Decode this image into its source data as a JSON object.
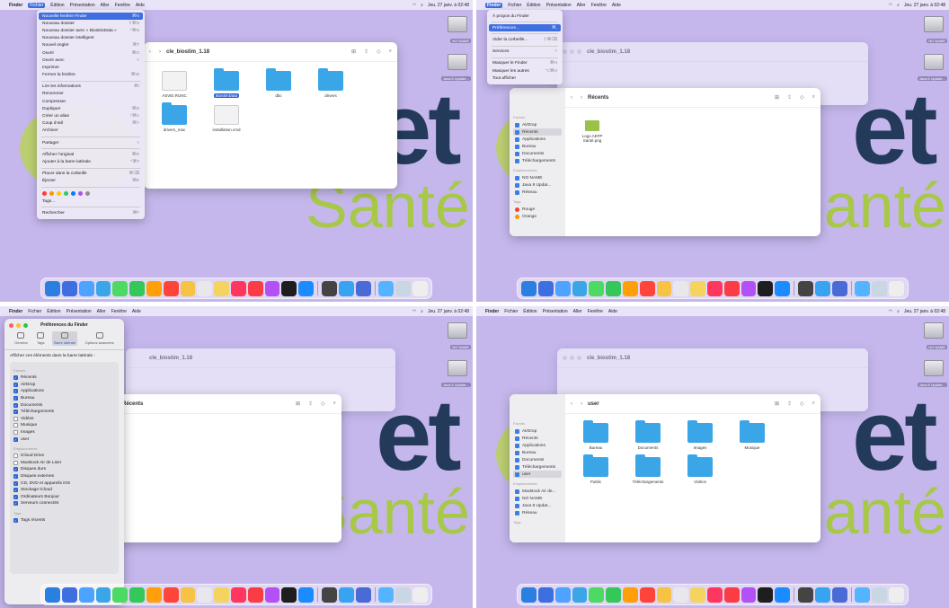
{
  "menubar": {
    "apple": "",
    "app": "Finder",
    "items": [
      "Fichier",
      "Édition",
      "Présentation",
      "Aller",
      "Fenêtre",
      "Aide"
    ],
    "clock": "Jeu. 27 janv. à 02:48"
  },
  "desktop": {
    "wall_big": "et",
    "wall_small": "Santé",
    "disk1": "NO NAME",
    "disk2": "Java 8 Update..."
  },
  "p1": {
    "window_title": "cle_biostim_1.18",
    "files": [
      {
        "name": "ASVEI.RUNC",
        "kind": "file"
      },
      {
        "name": "BiostimData",
        "kind": "folder",
        "selected": true
      },
      {
        "name": "dbc",
        "kind": "folder"
      },
      {
        "name": "drivers",
        "kind": "folder"
      },
      {
        "name": "drivers_mac",
        "kind": "folder"
      },
      {
        "name": "installation.cmd",
        "kind": "file"
      }
    ],
    "menu": [
      {
        "label": "Nouvelle fenêtre Finder",
        "sc": "⌘N",
        "hl": true
      },
      {
        "label": "Nouveau dossier",
        "sc": "⇧⌘N"
      },
      {
        "label": "Nouveau dossier avec « BiostimData »",
        "sc": "^⌘N"
      },
      {
        "label": "Nouveau dossier intelligent",
        "sc": ""
      },
      {
        "label": "Nouvel onglet",
        "sc": "⌘T"
      },
      {
        "label": "Ouvrir",
        "sc": "⌘O"
      },
      {
        "label": "Ouvrir avec",
        "sc": ">"
      },
      {
        "label": "Imprimer",
        "sc": ""
      },
      {
        "label": "Fermer la fenêtre",
        "sc": "⌘W"
      },
      {
        "sep": true
      },
      {
        "label": "Lire les informations",
        "sc": "⌘I"
      },
      {
        "label": "Renommer",
        "sc": ""
      },
      {
        "label": "Compresser",
        "sc": ""
      },
      {
        "label": "Dupliquer",
        "sc": "⌘D"
      },
      {
        "label": "Créer un alias",
        "sc": "^⌘A"
      },
      {
        "label": "Coup d’œil",
        "sc": "⌘Y"
      },
      {
        "label": "Archiver",
        "sc": ""
      },
      {
        "sep": true
      },
      {
        "label": "Partager",
        "sc": ">"
      },
      {
        "sep": true
      },
      {
        "label": "Afficher l’original",
        "sc": "⌘R"
      },
      {
        "label": "Ajouter à la barre latérale",
        "sc": "^⌘T"
      },
      {
        "sep": true
      },
      {
        "label": "Placer dans la corbeille",
        "sc": "⌘⌫"
      },
      {
        "label": "Éjecter",
        "sc": "⌘E"
      },
      {
        "sep": true
      },
      {
        "tags": true
      },
      {
        "label": "Tags…",
        "sc": ""
      },
      {
        "sep": true
      },
      {
        "label": "Rechercher",
        "sc": "⌘F"
      }
    ]
  },
  "p2": {
    "bg_title": "cle_biostim_1.18",
    "title": "Récents",
    "file": "Logo AEFP Santé.png",
    "sidebar": {
      "favorites_head": "Favoris",
      "items": [
        "AirDrop",
        "Récents",
        "Applications",
        "Bureau",
        "Documents",
        "Téléchargements"
      ],
      "active": 1,
      "locations_head": "Emplacements",
      "locations": [
        "NO NAME",
        "Java 8 Updat...",
        "Réseau"
      ],
      "tags_head": "Tags",
      "tags": [
        "Rouge",
        "Orange"
      ]
    },
    "menu": [
      {
        "label": "À propos du Finder",
        "sc": ""
      },
      {
        "sep": true
      },
      {
        "label": "Préférences…",
        "sc": "⌘,",
        "hl": true
      },
      {
        "sep": true
      },
      {
        "label": "Vider la corbeille…",
        "sc": "⇧⌘⌫"
      },
      {
        "sep": true
      },
      {
        "label": "Services",
        "sc": ">"
      },
      {
        "sep": true
      },
      {
        "label": "Masquer le Finder",
        "sc": "⌘H"
      },
      {
        "label": "Masquer les autres",
        "sc": "⌥⌘H"
      },
      {
        "label": "Tout afficher",
        "sc": ""
      }
    ]
  },
  "p3": {
    "title": "Préférences du Finder",
    "tabs": [
      "Général",
      "Tags",
      "Barre latérale",
      "Options avancées"
    ],
    "active_tab": 2,
    "intro": "Afficher ces éléments dans la barre latérale :",
    "groups": [
      {
        "head": "Favoris",
        "items": [
          {
            "label": "Récents",
            "on": true
          },
          {
            "label": "AirDrop",
            "on": true
          },
          {
            "label": "Applications",
            "on": true
          },
          {
            "label": "Bureau",
            "on": true
          },
          {
            "label": "Documents",
            "on": true
          },
          {
            "label": "Téléchargements",
            "on": true
          },
          {
            "label": "Vidéos",
            "on": false
          },
          {
            "label": "Musique",
            "on": false
          },
          {
            "label": "Images",
            "on": false
          },
          {
            "label": "user",
            "on": true
          }
        ]
      },
      {
        "head": "Emplacements",
        "items": [
          {
            "label": "iCloud Drive",
            "on": false
          },
          {
            "label": "MacBook Air de Liser",
            "on": false
          },
          {
            "label": "Disques durs",
            "on": true
          },
          {
            "label": "Disques externes",
            "on": true
          },
          {
            "label": "CD, DVD et appareils iOS",
            "on": true
          },
          {
            "label": "Stockage iCloud",
            "on": true
          },
          {
            "label": "Ordinateurs Bonjour",
            "on": true
          },
          {
            "label": "Serveurs connectés",
            "on": true
          }
        ]
      },
      {
        "head": "Tags",
        "items": [
          {
            "label": "Tags récents",
            "on": true
          }
        ]
      }
    ],
    "bg_title": "cle_biostim_1.18",
    "front_title": "Récents"
  },
  "p4": {
    "bg_title": "cle_biostim_1.18",
    "title": "user",
    "folders": [
      "Bureau",
      "Documents",
      "Images",
      "Musique",
      "Public",
      "Téléchargements",
      "Vidéos"
    ],
    "sidebar": {
      "favorites_head": "Favoris",
      "items": [
        "AirDrop",
        "Récents",
        "Applications",
        "Bureau",
        "Documents",
        "Téléchargements",
        "user"
      ],
      "active": 6,
      "locations_head": "Emplacements",
      "locations": [
        "MacBook Air de...",
        "NO NAME",
        "Java 8 Updat...",
        "Réseau"
      ],
      "tags_head": "Tags"
    }
  }
}
